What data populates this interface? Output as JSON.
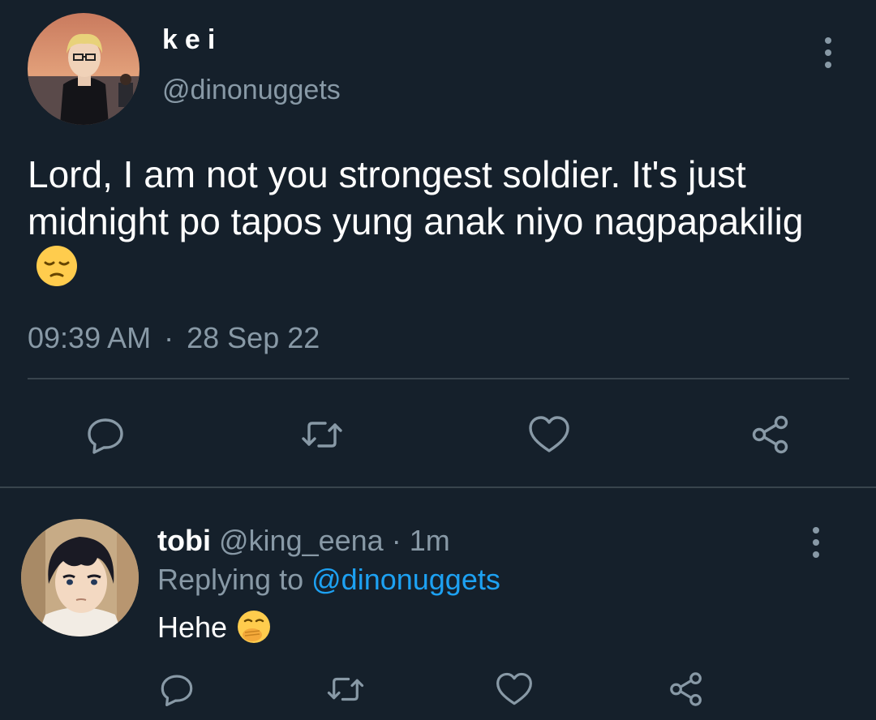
{
  "main_tweet": {
    "author_name": "kei",
    "author_handle": "@dinonuggets",
    "text": "Lord, I am not you strongest soldier. It's just midnight po tapos yung anak niyo nagpapakilig",
    "emoji": "pensive-face",
    "time": "09:39 AM",
    "separator": "·",
    "date": "28 Sep 22",
    "actions": [
      "reply-icon",
      "retweet-icon",
      "like-icon",
      "share-icon"
    ]
  },
  "reply": {
    "author_name": "tobi",
    "author_handle": "@king_eena",
    "separator": "·",
    "time": "1m",
    "replying_to_label": "Replying to",
    "replying_to_handle": "@dinonuggets",
    "text": "Hehe",
    "emoji": "face-with-hand-over-mouth",
    "actions": [
      "reply-icon",
      "retweet-icon",
      "like-icon",
      "share-icon"
    ]
  },
  "colors": {
    "background": "#15202b",
    "primary_text": "#ffffff",
    "secondary_text": "#8899a6",
    "link": "#1da1f2",
    "divider": "#38444d"
  }
}
